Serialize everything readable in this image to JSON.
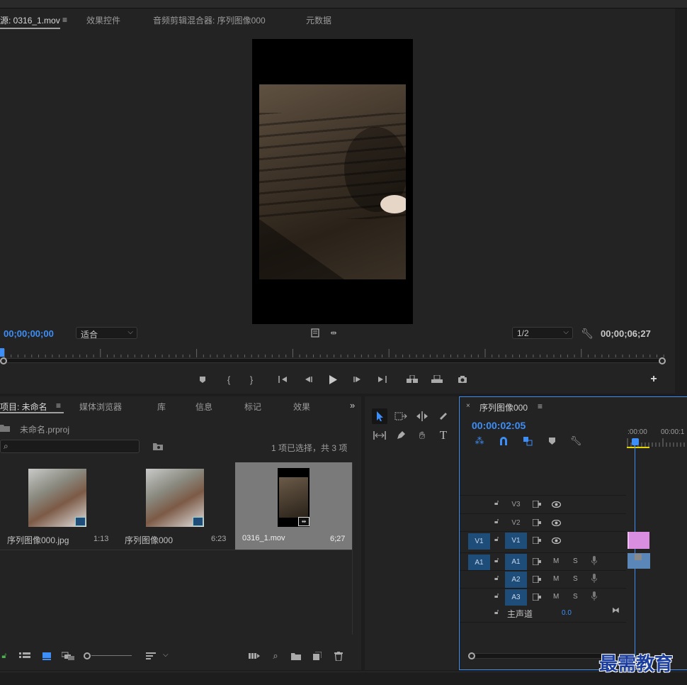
{
  "source_monitor": {
    "tabs": [
      "源: 0316_1.mov",
      "效果控件",
      "音频剪辑混合器: 序列图像000",
      "元数据"
    ],
    "menu_icon": "menu-icon",
    "timecode_left": "00;00;00;00",
    "timecode_right": "00;00;06;27",
    "fit_value": "适合",
    "resolution_value": "1/2"
  },
  "project_panel": {
    "tabs": [
      "项目: 未命名",
      "媒体浏览器",
      "库",
      "信息",
      "标记",
      "效果"
    ],
    "project_file": "未命名.prproj",
    "search_placeholder": "",
    "selection_status": "1 项已选择，共 3 项",
    "items": [
      {
        "name": "序列图像000.jpg",
        "duration": "1:13",
        "selected": false,
        "kind": "image"
      },
      {
        "name": "序列图像000",
        "duration": "6:23",
        "selected": false,
        "kind": "sequence"
      },
      {
        "name": "0316_1.mov",
        "duration": "6;27",
        "selected": true,
        "kind": "video"
      }
    ]
  },
  "timeline": {
    "sequence_name": "序列图像000",
    "timecode": "00:00:02:05",
    "ruler_labels": [
      ":00:00",
      "00:00:1"
    ],
    "tracks": [
      {
        "source": "",
        "name": "V3",
        "type": "video"
      },
      {
        "source": "",
        "name": "V2",
        "type": "video"
      },
      {
        "source": "V1",
        "name": "V1",
        "type": "video"
      },
      {
        "source": "A1",
        "name": "A1",
        "type": "audio",
        "m": "M",
        "s": "S"
      },
      {
        "source": "",
        "name": "A2",
        "type": "audio",
        "m": "M",
        "s": "S"
      },
      {
        "source": "",
        "name": "A3",
        "type": "audio",
        "m": "M",
        "s": "S"
      }
    ],
    "master": {
      "label": "主声道",
      "value": "0.0"
    }
  },
  "watermark": "最需教育",
  "colors": {
    "accent": "#3d8ef7",
    "track_blue": "#1f4d79",
    "video_clip": "#d98ee0",
    "audio_clip": "#5a86b8",
    "playhead": "#3d8ef7"
  }
}
